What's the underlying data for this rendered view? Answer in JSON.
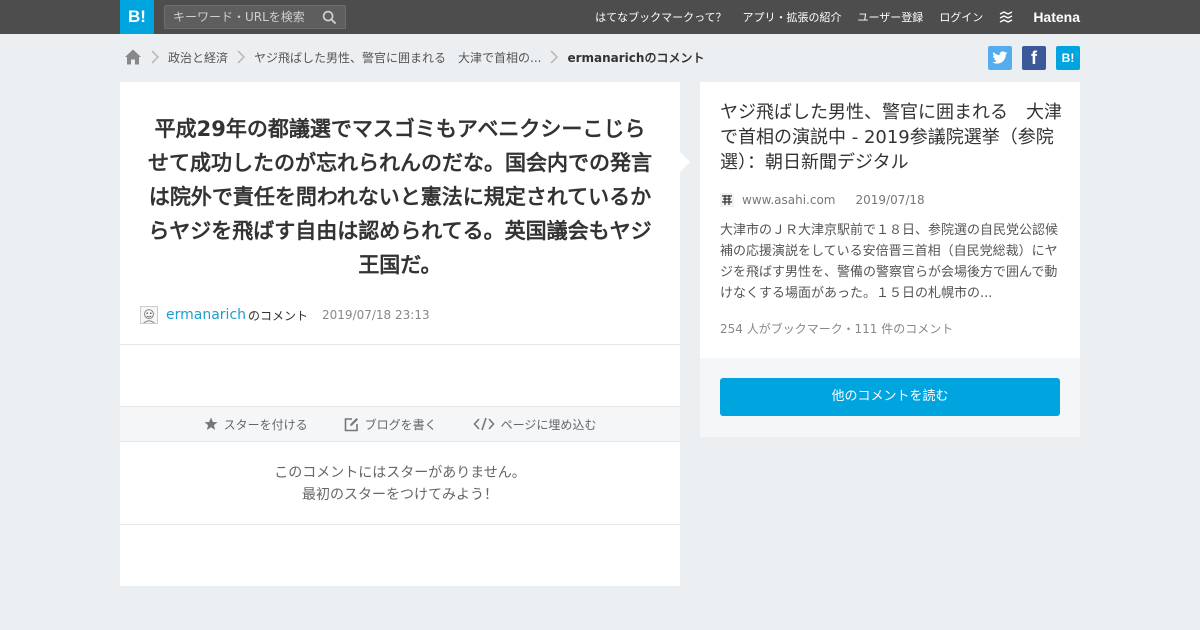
{
  "header": {
    "logo_text": "B!",
    "search_placeholder": "キーワード・URLを検索",
    "nav_items": [
      "はてなブックマークって？",
      "アプリ・拡張の紹介",
      "ユーザー登録",
      "ログイン"
    ],
    "hatena_label": "Hatena"
  },
  "breadcrumb": {
    "items": [
      "政治と経済",
      "ヤジ飛ばした男性、警官に囲まれる　大津で首相の..."
    ],
    "current": "ermanarichのコメント"
  },
  "share": {
    "twitter_icon": "twitter-icon",
    "facebook_icon": "facebook-icon",
    "facebook_glyph": "f",
    "hatebu_glyph": "B!"
  },
  "comment": {
    "text": "平成29年の都議選でマスゴミもアベニクシーこじらせて成功したのが忘れられんのだな。国会内での発言は院外で責任を問われないと憲法に規定されているからヤジを飛ばす自由は認められてる。英国議会もヤジ王国だ。",
    "user": "ermanarich",
    "suffix": "のコメント",
    "timestamp": "2019/07/18 23:13"
  },
  "actions": {
    "star": "スターを付ける",
    "blog": "ブログを書く",
    "embed": "ページに埋め込む"
  },
  "stars": {
    "line1": "このコメントにはスターがありません。",
    "line2": "最初のスターをつけてみよう！"
  },
  "entry": {
    "title": "ヤジ飛ばした男性、警官に囲まれる　大津で首相の演説中 - 2019参議院選挙（参院選）：朝日新聞デジタル",
    "domain": "www.asahi.com",
    "date": "2019/07/18",
    "summary": "大津市のＪＲ大津京駅前で１８日、参院選の自民党公認候補の応援演説をしている安倍晋三首相（自民党総裁）にヤジを飛ばす男性を、警備の警察官らが会場後方で囲んで動けなくする場面があった。１５日の札幌市の...",
    "counts": "254 人がブックマーク・111 件のコメント"
  },
  "read_button": "他のコメントを読む",
  "colors": {
    "brand": "#00a4de",
    "topbar": "#4d4d4d",
    "link": "#1a9fd1",
    "background": "#eceff2"
  }
}
